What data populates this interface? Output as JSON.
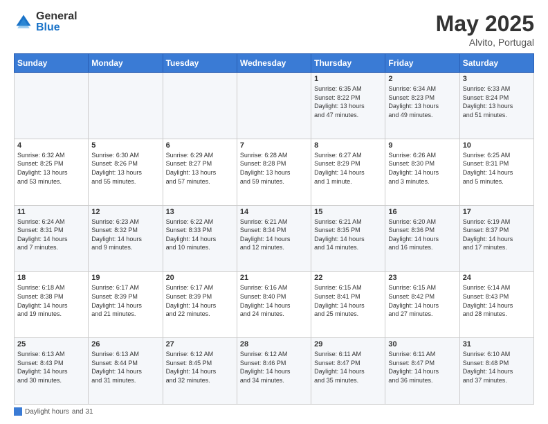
{
  "logo": {
    "general": "General",
    "blue": "Blue"
  },
  "title": {
    "month": "May 2025",
    "location": "Alvito, Portugal"
  },
  "weekdays": [
    "Sunday",
    "Monday",
    "Tuesday",
    "Wednesday",
    "Thursday",
    "Friday",
    "Saturday"
  ],
  "footer": {
    "label1": "Daylight hours",
    "label2": "and 31"
  },
  "weeks": [
    [
      {
        "day": "",
        "info": ""
      },
      {
        "day": "",
        "info": ""
      },
      {
        "day": "",
        "info": ""
      },
      {
        "day": "",
        "info": ""
      },
      {
        "day": "1",
        "info": "Sunrise: 6:35 AM\nSunset: 8:22 PM\nDaylight: 13 hours\nand 47 minutes."
      },
      {
        "day": "2",
        "info": "Sunrise: 6:34 AM\nSunset: 8:23 PM\nDaylight: 13 hours\nand 49 minutes."
      },
      {
        "day": "3",
        "info": "Sunrise: 6:33 AM\nSunset: 8:24 PM\nDaylight: 13 hours\nand 51 minutes."
      }
    ],
    [
      {
        "day": "4",
        "info": "Sunrise: 6:32 AM\nSunset: 8:25 PM\nDaylight: 13 hours\nand 53 minutes."
      },
      {
        "day": "5",
        "info": "Sunrise: 6:30 AM\nSunset: 8:26 PM\nDaylight: 13 hours\nand 55 minutes."
      },
      {
        "day": "6",
        "info": "Sunrise: 6:29 AM\nSunset: 8:27 PM\nDaylight: 13 hours\nand 57 minutes."
      },
      {
        "day": "7",
        "info": "Sunrise: 6:28 AM\nSunset: 8:28 PM\nDaylight: 13 hours\nand 59 minutes."
      },
      {
        "day": "8",
        "info": "Sunrise: 6:27 AM\nSunset: 8:29 PM\nDaylight: 14 hours\nand 1 minute."
      },
      {
        "day": "9",
        "info": "Sunrise: 6:26 AM\nSunset: 8:30 PM\nDaylight: 14 hours\nand 3 minutes."
      },
      {
        "day": "10",
        "info": "Sunrise: 6:25 AM\nSunset: 8:31 PM\nDaylight: 14 hours\nand 5 minutes."
      }
    ],
    [
      {
        "day": "11",
        "info": "Sunrise: 6:24 AM\nSunset: 8:31 PM\nDaylight: 14 hours\nand 7 minutes."
      },
      {
        "day": "12",
        "info": "Sunrise: 6:23 AM\nSunset: 8:32 PM\nDaylight: 14 hours\nand 9 minutes."
      },
      {
        "day": "13",
        "info": "Sunrise: 6:22 AM\nSunset: 8:33 PM\nDaylight: 14 hours\nand 10 minutes."
      },
      {
        "day": "14",
        "info": "Sunrise: 6:21 AM\nSunset: 8:34 PM\nDaylight: 14 hours\nand 12 minutes."
      },
      {
        "day": "15",
        "info": "Sunrise: 6:21 AM\nSunset: 8:35 PM\nDaylight: 14 hours\nand 14 minutes."
      },
      {
        "day": "16",
        "info": "Sunrise: 6:20 AM\nSunset: 8:36 PM\nDaylight: 14 hours\nand 16 minutes."
      },
      {
        "day": "17",
        "info": "Sunrise: 6:19 AM\nSunset: 8:37 PM\nDaylight: 14 hours\nand 17 minutes."
      }
    ],
    [
      {
        "day": "18",
        "info": "Sunrise: 6:18 AM\nSunset: 8:38 PM\nDaylight: 14 hours\nand 19 minutes."
      },
      {
        "day": "19",
        "info": "Sunrise: 6:17 AM\nSunset: 8:39 PM\nDaylight: 14 hours\nand 21 minutes."
      },
      {
        "day": "20",
        "info": "Sunrise: 6:17 AM\nSunset: 8:39 PM\nDaylight: 14 hours\nand 22 minutes."
      },
      {
        "day": "21",
        "info": "Sunrise: 6:16 AM\nSunset: 8:40 PM\nDaylight: 14 hours\nand 24 minutes."
      },
      {
        "day": "22",
        "info": "Sunrise: 6:15 AM\nSunset: 8:41 PM\nDaylight: 14 hours\nand 25 minutes."
      },
      {
        "day": "23",
        "info": "Sunrise: 6:15 AM\nSunset: 8:42 PM\nDaylight: 14 hours\nand 27 minutes."
      },
      {
        "day": "24",
        "info": "Sunrise: 6:14 AM\nSunset: 8:43 PM\nDaylight: 14 hours\nand 28 minutes."
      }
    ],
    [
      {
        "day": "25",
        "info": "Sunrise: 6:13 AM\nSunset: 8:43 PM\nDaylight: 14 hours\nand 30 minutes."
      },
      {
        "day": "26",
        "info": "Sunrise: 6:13 AM\nSunset: 8:44 PM\nDaylight: 14 hours\nand 31 minutes."
      },
      {
        "day": "27",
        "info": "Sunrise: 6:12 AM\nSunset: 8:45 PM\nDaylight: 14 hours\nand 32 minutes."
      },
      {
        "day": "28",
        "info": "Sunrise: 6:12 AM\nSunset: 8:46 PM\nDaylight: 14 hours\nand 34 minutes."
      },
      {
        "day": "29",
        "info": "Sunrise: 6:11 AM\nSunset: 8:47 PM\nDaylight: 14 hours\nand 35 minutes."
      },
      {
        "day": "30",
        "info": "Sunrise: 6:11 AM\nSunset: 8:47 PM\nDaylight: 14 hours\nand 36 minutes."
      },
      {
        "day": "31",
        "info": "Sunrise: 6:10 AM\nSunset: 8:48 PM\nDaylight: 14 hours\nand 37 minutes."
      }
    ]
  ]
}
